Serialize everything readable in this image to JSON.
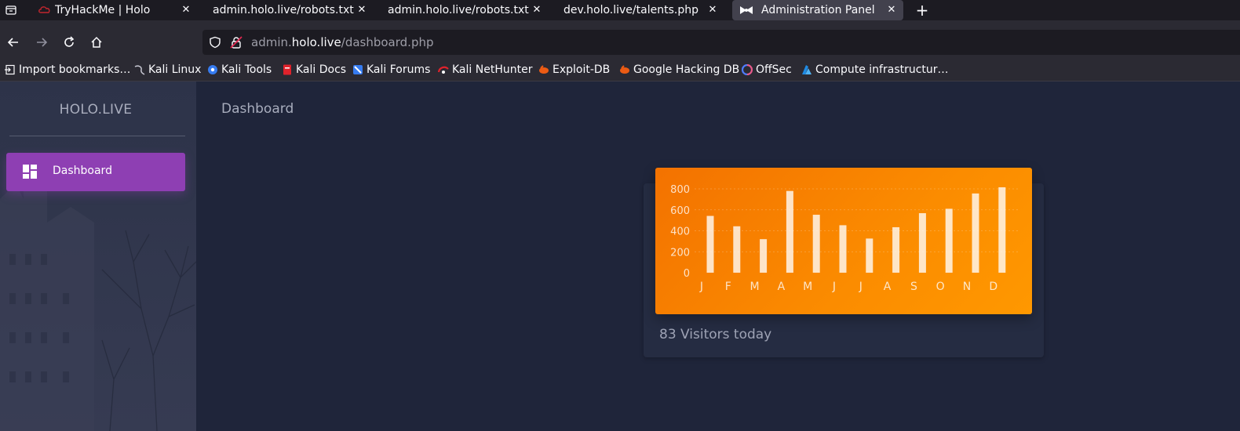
{
  "browser": {
    "tabs": [
      {
        "title": "TryHackMe | Holo",
        "active": false
      },
      {
        "title": "admin.holo.live/robots.txt",
        "active": false
      },
      {
        "title": "admin.holo.live/robots.txt",
        "active": false
      },
      {
        "title": "dev.holo.live/talents.php",
        "active": false
      },
      {
        "title": "Administration Panel",
        "active": true
      }
    ],
    "url": {
      "prefix": "admin.",
      "host": "holo.live",
      "path": "/dashboard.php"
    },
    "bookmarks": [
      {
        "label": "Import bookmarks…",
        "icon": "import-icon"
      },
      {
        "label": "Kali Linux",
        "icon": "kali-dragon-icon"
      },
      {
        "label": "Kali Tools",
        "icon": "kali-tools-icon"
      },
      {
        "label": "Kali Docs",
        "icon": "kali-docs-icon"
      },
      {
        "label": "Kali Forums",
        "icon": "kali-forums-icon"
      },
      {
        "label": "Kali NetHunter",
        "icon": "nethunter-icon"
      },
      {
        "label": "Exploit-DB",
        "icon": "exploit-db-icon"
      },
      {
        "label": "Google Hacking DB",
        "icon": "ghdb-icon"
      },
      {
        "label": "OffSec",
        "icon": "offsec-icon"
      },
      {
        "label": "Compute infrastructur…",
        "icon": "azure-icon"
      }
    ]
  },
  "sidebar": {
    "logo": "HOLO.LIVE",
    "items": [
      {
        "label": "Dashboard",
        "icon": "dashboard-icon",
        "active": true
      }
    ]
  },
  "main": {
    "title": "Dashboard",
    "card_footer": "83 Visitors today"
  },
  "colors": {
    "accent_purple": "#8e3fb3",
    "chart_orange": "#fb8c00",
    "page_bg": "#1f253a",
    "sidebar_bg": "#2b3147"
  },
  "chart_data": {
    "type": "bar",
    "categories": [
      "J",
      "F",
      "M",
      "A",
      "M",
      "J",
      "J",
      "A",
      "S",
      "O",
      "N",
      "D"
    ],
    "values": [
      542,
      443,
      320,
      780,
      553,
      453,
      326,
      434,
      568,
      610,
      756,
      895
    ],
    "yticks": [
      "800",
      "600",
      "400",
      "200",
      "0"
    ],
    "ylim": [
      0,
      900
    ],
    "grid": true,
    "title": "",
    "xlabel": "",
    "ylabel": ""
  }
}
